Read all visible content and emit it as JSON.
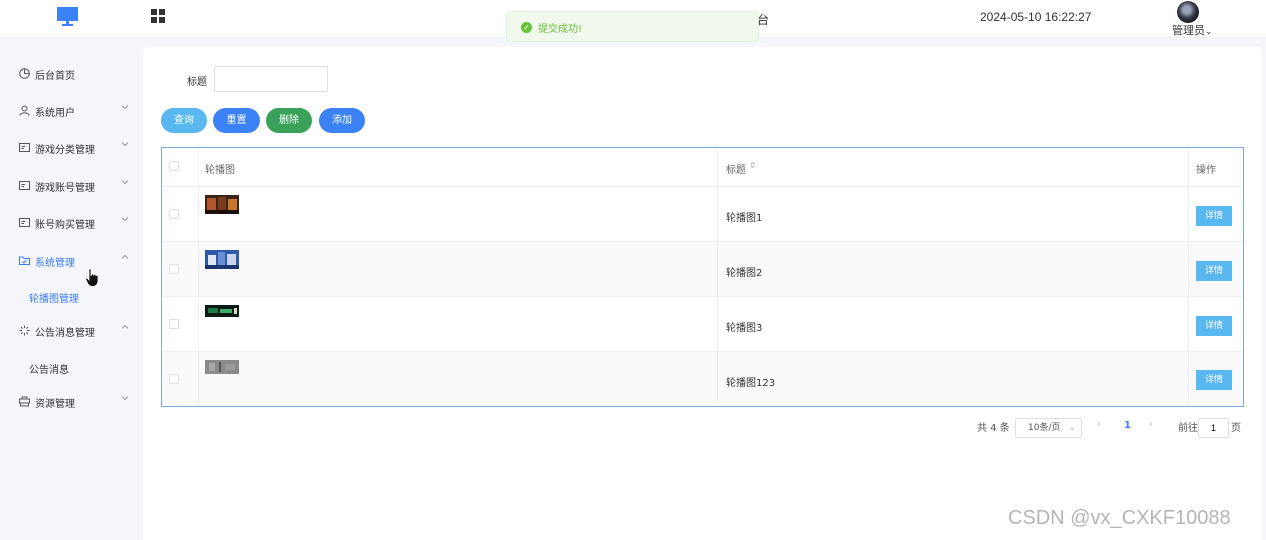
{
  "header": {
    "system_title_fragment": "台",
    "datetime": "2024-05-10 16:22:27",
    "user_label": "管理员",
    "user_caret": "⌄"
  },
  "toast": {
    "message": "提交成功!",
    "icon": "check-circle-icon"
  },
  "sidebar": {
    "items": [
      {
        "label": "后台首页",
        "icon": "dashboard-icon",
        "has_chevron": false
      },
      {
        "label": "系统用户",
        "icon": "user-icon",
        "has_chevron": true
      },
      {
        "label": "游戏分类管理",
        "icon": "card-icon",
        "has_chevron": true
      },
      {
        "label": "游戏账号管理",
        "icon": "card-icon",
        "has_chevron": true
      },
      {
        "label": "账号购买管理",
        "icon": "card-icon",
        "has_chevron": true
      },
      {
        "label": "系统管理",
        "icon": "folder-icon",
        "has_chevron": true,
        "active": true
      },
      {
        "label": "公告消息管理",
        "icon": "sparkle-icon",
        "has_chevron": true
      },
      {
        "label": "资源管理",
        "icon": "box-icon",
        "has_chevron": true
      }
    ],
    "sub_items": [
      {
        "label": "轮播图管理",
        "active": true
      },
      {
        "label": "公告消息"
      }
    ]
  },
  "search": {
    "label": "标题",
    "value": "",
    "placeholder": ""
  },
  "buttons": {
    "query": "查询",
    "reset": "重置",
    "delete": "删除",
    "add": "添加"
  },
  "table": {
    "headers": {
      "image": "轮播图",
      "title": "标题",
      "op": "操作"
    },
    "rows": [
      {
        "title": "轮播图1",
        "action": "详情"
      },
      {
        "title": "轮播图2",
        "action": "详情"
      },
      {
        "title": "轮播图3",
        "action": "详情"
      },
      {
        "title": "轮播图123",
        "action": "详情"
      }
    ]
  },
  "pagination": {
    "total": "共 4 条",
    "page_size": "10条/页",
    "current": "1",
    "goto_prefix": "前往",
    "goto_value": "1",
    "goto_suffix": "页"
  },
  "watermark": "CSDN @vx_CXKF10088",
  "colors": {
    "primary": "#3b82f6",
    "info": "#5ab8f0",
    "success": "#3aa15a",
    "toast_text": "#67c23a",
    "active_menu": "#3b7cff"
  }
}
